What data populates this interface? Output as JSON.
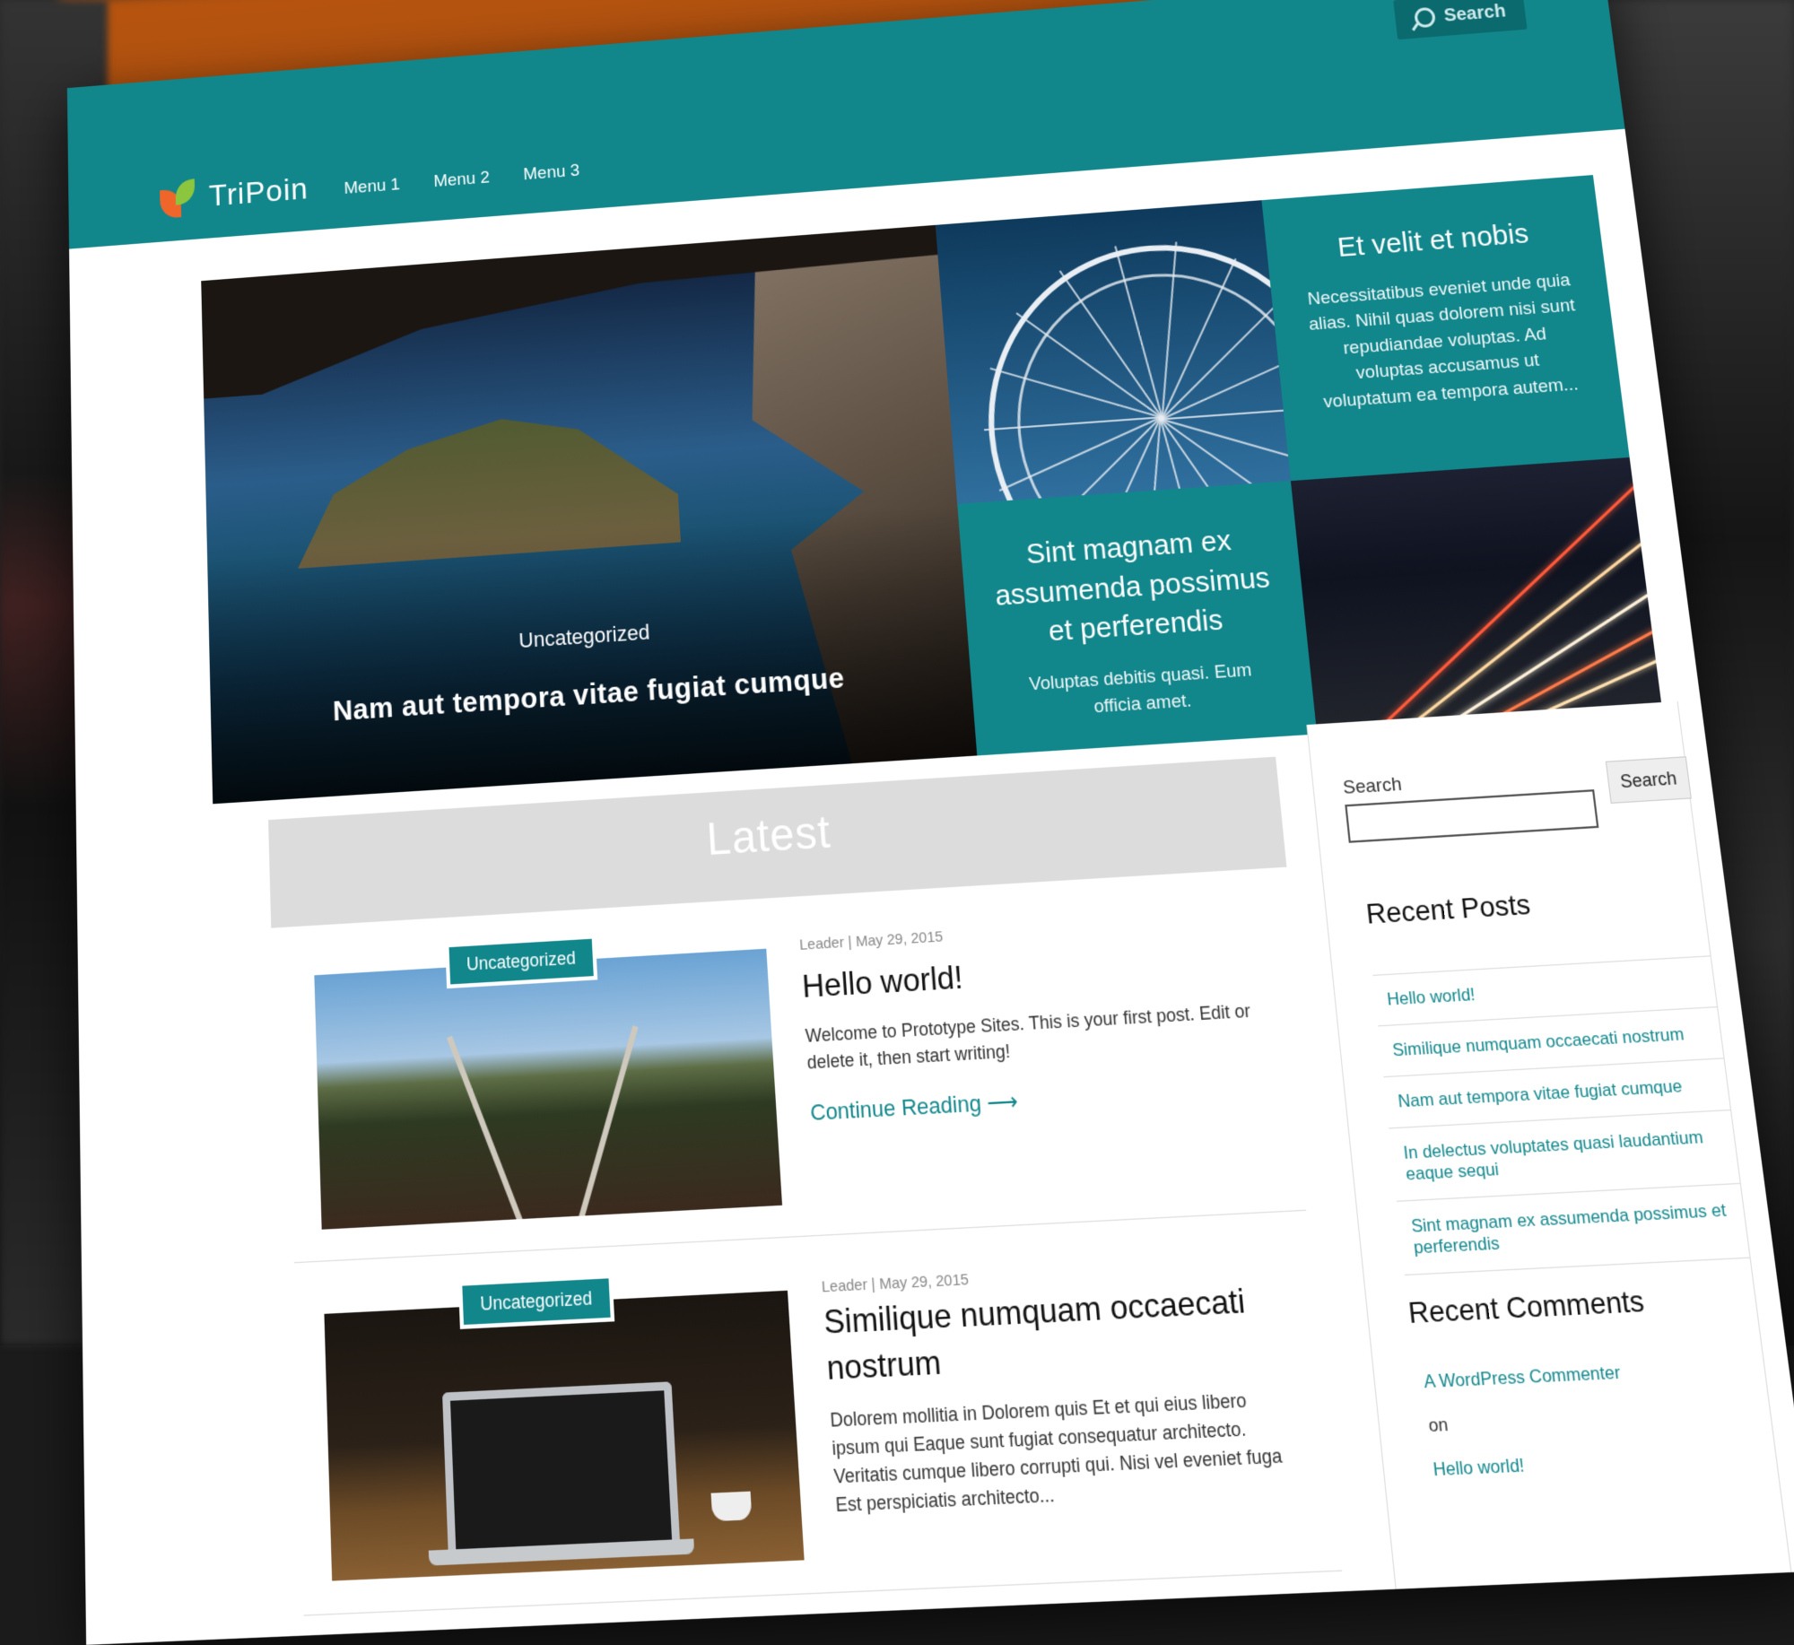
{
  "header": {
    "search_label": "Search",
    "logo_text": "TriPoin",
    "menu": [
      "Menu 1",
      "Menu 2",
      "Menu 3"
    ]
  },
  "hero": {
    "main": {
      "category": "Uncategorized",
      "title": "Nam aut tempora vitae fugiat cumque"
    },
    "tile_top": {
      "title": "Et velit et nobis",
      "excerpt": "Necessitatibus eveniet unde quia alias. Nihil quas dolorem nisi sunt repudiandae voluptas. Ad voluptas accusamus ut voluptatum ea tempora autem..."
    },
    "tile_bottom": {
      "title": "Sint magnam ex assumenda possimus et perferendis",
      "excerpt": "Voluptas debitis quasi. Eum officia amet."
    }
  },
  "latest": {
    "heading": "Latest",
    "posts": [
      {
        "category": "Uncategorized",
        "meta": "Leader | May 29, 2015",
        "title": "Hello world!",
        "excerpt": "Welcome to Prototype Sites. This is your first post. Edit or delete it, then start writing!",
        "more": "Continue Reading ⟶"
      },
      {
        "category": "Uncategorized",
        "meta": "Leader | May 29, 2015",
        "title": "Similique numquam occaecati nostrum",
        "excerpt": "Dolorem mollitia in Dolorem quis Et et qui eius libero ipsum qui Eaque sunt fugiat consequatur architecto. Veritatis cumque libero corrupti qui. Nisi vel eveniet fuga Est perspiciatis architecto..."
      }
    ]
  },
  "sidebar": {
    "search_label": "Search",
    "search_button": "Search",
    "search_value": "",
    "recent_posts_heading": "Recent Posts",
    "recent_posts": [
      "Hello world!",
      "Similique numquam occaecati nostrum",
      "Nam aut tempora vitae fugiat cumque",
      "In delectus voluptates quasi laudantium eaque sequi",
      "Sint magnam ex assumenda possimus et perferendis"
    ],
    "recent_comments_heading": "Recent Comments",
    "comment_author": "A WordPress Commenter",
    "comment_on": "on",
    "comment_post": "Hello world!"
  },
  "colors": {
    "accent": "#11868b",
    "logo_orange": "#f0662a",
    "logo_green": "#8cc63f"
  }
}
